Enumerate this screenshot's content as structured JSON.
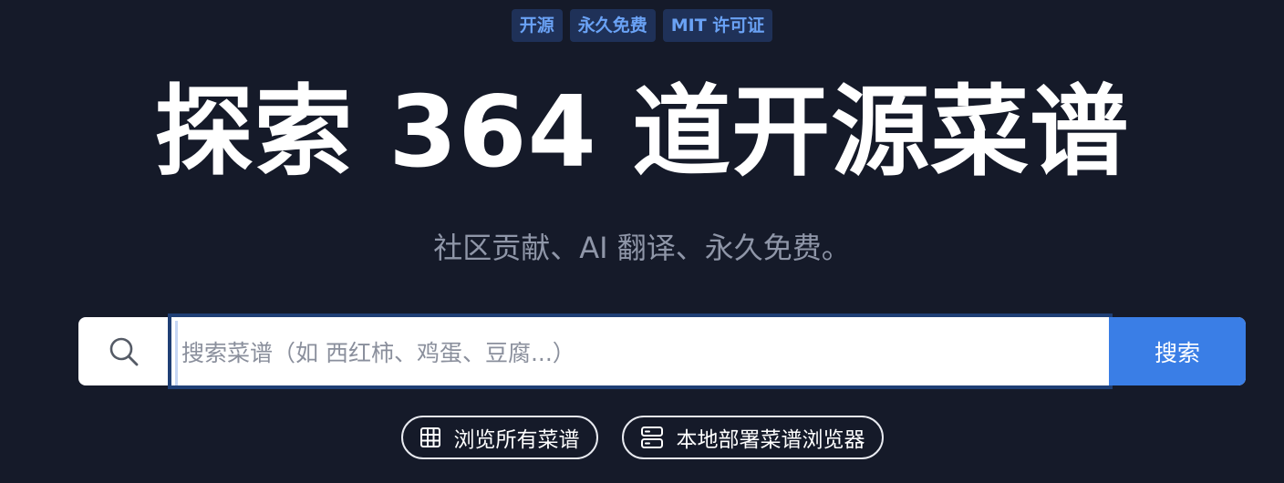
{
  "badges": [
    "开源",
    "永久免费",
    "MIT 许可证"
  ],
  "hero": {
    "title": "探索 364 道开源菜谱",
    "subtitle": "社区贡献、AI 翻译、永久免费。"
  },
  "search": {
    "placeholder": "搜索菜谱（如 西红柿、鸡蛋、豆腐...）",
    "button_label": "搜索",
    "icon": "search-icon"
  },
  "actions": [
    {
      "label": "浏览所有菜谱",
      "icon": "grid-icon"
    },
    {
      "label": "本地部署菜谱浏览器",
      "icon": "server-icon"
    }
  ],
  "colors": {
    "background": "#151a29",
    "badge_bg": "#1f3158",
    "badge_text": "#6aa2f5",
    "accent": "#3a7ee6",
    "subtitle": "#8f96a8"
  }
}
